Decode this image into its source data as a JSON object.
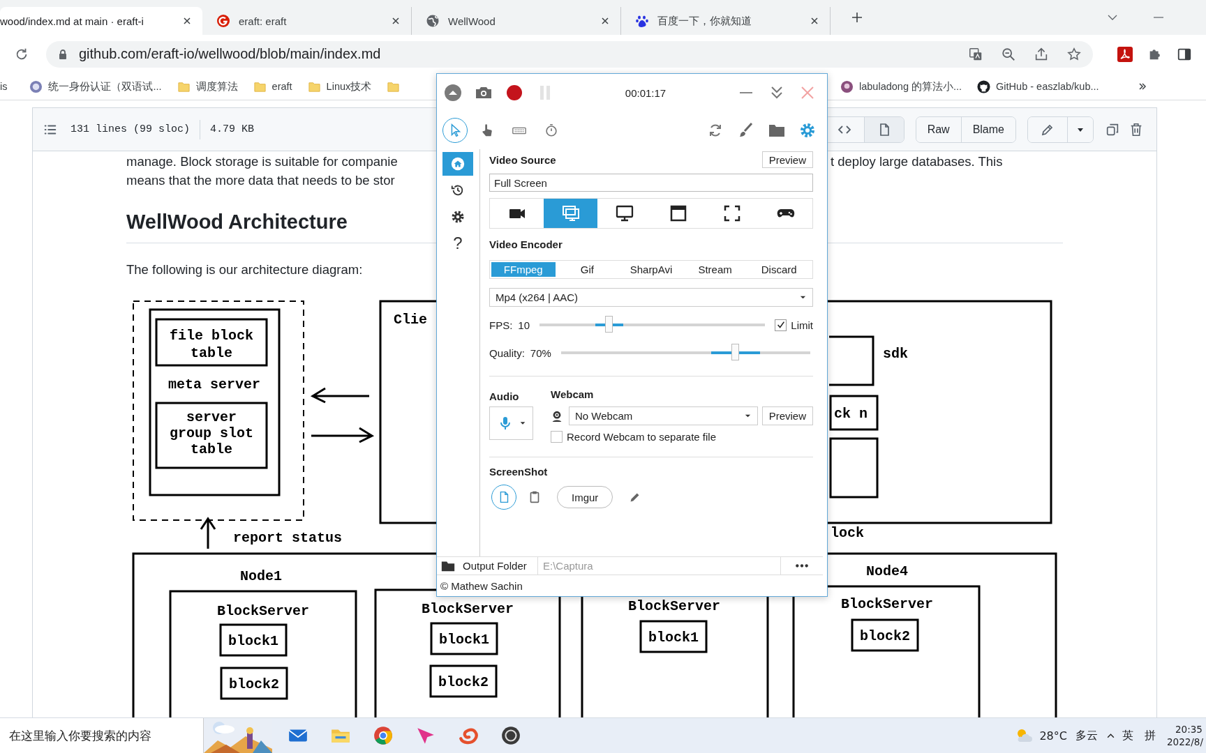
{
  "browser": {
    "tabs": [
      {
        "title": "wood/index.md at main · eraft-i",
        "selected": true
      },
      {
        "kind": "ring",
        "title": "eraft: eraft",
        "selected": false
      },
      {
        "kind": "globe",
        "title": "WellWood",
        "selected": false
      },
      {
        "kind": "paw",
        "title": "百度一下，你就知道",
        "selected": false
      }
    ],
    "url": "github.com/eraft-io/wellwood/blob/main/index.md",
    "bookmarks_left": [
      {
        "kind": "text",
        "label": "is"
      },
      {
        "kind": "site",
        "label": "统一身份认证（双语试..."
      },
      {
        "kind": "folder",
        "label": "调度算法"
      },
      {
        "kind": "folder",
        "label": "eraft"
      },
      {
        "kind": "folder",
        "label": "Linux技术"
      },
      {
        "kind": "folder"
      }
    ],
    "bookmarks_right": [
      {
        "kind": "site",
        "label": "labuladong 的算法小..."
      },
      {
        "kind": "github",
        "label": "GitHub - easzlab/kub..."
      }
    ]
  },
  "file_header": {
    "lines": "131 lines (99 sloc)",
    "size": "4.79 KB",
    "views": [
      {
        "kind": "code",
        "selected": false
      },
      {
        "kind": "preview",
        "selected": true
      }
    ],
    "actions": [
      "Raw",
      "Blame"
    ]
  },
  "article": {
    "lines": [
      {
        "left": "manage. Block storage is suitable for companie",
        "right": "t deploy large databases. This"
      },
      {
        "left": "means that the more data that needs to be stor"
      }
    ],
    "heading": "WellWood Architecture",
    "lead": "The following is our architecture diagram:",
    "diagram": {
      "file_table": [
        "file block",
        "table"
      ],
      "meta": "meta server",
      "slot_table": [
        "server",
        "group slot",
        "table"
      ],
      "report": "report status",
      "client": "Clie",
      "sdk": "sdk",
      "block_n": "ck n",
      "lock": "lock",
      "nodes": [
        {
          "label": "Node1",
          "server": "BlockServer",
          "blocks": [
            "block1",
            "block2"
          ]
        },
        {
          "server": "BlockServer",
          "blocks": [
            "block1",
            "block2"
          ]
        },
        {
          "server": "BlockServer",
          "blocks": [
            "block1"
          ]
        },
        {
          "label": "Node4",
          "server": "BlockServer",
          "blocks": [
            "block2"
          ]
        }
      ]
    }
  },
  "recorder": {
    "timer": "00:01:17",
    "tools": [
      {
        "kind": "cursor",
        "selected": true
      },
      {
        "kind": "hand",
        "selected": false
      },
      {
        "kind": "keyboard",
        "selected": false
      },
      {
        "kind": "timer",
        "selected": false
      }
    ],
    "nav": [
      {
        "kind": "home",
        "selected": true
      },
      {
        "kind": "history",
        "selected": false
      },
      {
        "kind": "settings",
        "selected": false
      },
      {
        "kind": "help",
        "label": "?",
        "selected": false
      }
    ],
    "video_source": {
      "title": "Video Source",
      "preview": "Preview",
      "value": "Full Screen",
      "sources": [
        {
          "kind": "camera",
          "selected": false
        },
        {
          "kind": "screens",
          "selected": true
        },
        {
          "kind": "monitor",
          "selected": false
        },
        {
          "kind": "window",
          "selected": false
        },
        {
          "kind": "region",
          "selected": false
        },
        {
          "kind": "gamepad",
          "selected": false
        }
      ]
    },
    "video_encoder": {
      "title": "Video Encoder",
      "tabs": [
        {
          "label": "FFmpeg",
          "selected": true
        },
        {
          "label": "Gif",
          "selected": false
        },
        {
          "label": "SharpAvi",
          "selected": false
        },
        {
          "label": "Stream",
          "selected": false
        },
        {
          "label": "Discard",
          "selected": false
        }
      ],
      "format": "Mp4 (x264 | AAC)",
      "fps": {
        "label": "FPS:",
        "value": "10",
        "level": 0.31,
        "limit": {
          "label": "Limit",
          "checked": true
        }
      },
      "quality": {
        "label": "Quality:",
        "value": "70%",
        "level": 0.7
      }
    },
    "audio": {
      "title": "Audio"
    },
    "webcam": {
      "title": "Webcam",
      "device": "No Webcam",
      "preview": "Preview",
      "separate": {
        "label": "Record Webcam to separate file",
        "checked": false
      }
    },
    "screenshot": {
      "title": "ScreenShot",
      "targets": [
        {
          "kind": "disk",
          "selected": true
        },
        {
          "kind": "clipboard",
          "selected": false
        },
        {
          "kind": "imgur",
          "label": "Imgur",
          "selected": false
        },
        {
          "kind": "editor",
          "selected": false
        }
      ]
    },
    "output": {
      "label": "Output Folder",
      "path": "E:\\Captura"
    },
    "copyright": "© Mathew Sachin"
  },
  "taskbar": {
    "placeholder": "在这里输入你要搜索的内容",
    "apps": [
      {
        "kind": "mail"
      },
      {
        "kind": "folder"
      },
      {
        "kind": "browser"
      },
      {
        "kind": "arrow"
      },
      {
        "kind": "swirl"
      },
      {
        "kind": "recorder"
      }
    ],
    "temperature": "28°C",
    "weather": "多云",
    "ime": [
      "英",
      "拼"
    ],
    "time": "20:35",
    "date": "2022/8/"
  }
}
